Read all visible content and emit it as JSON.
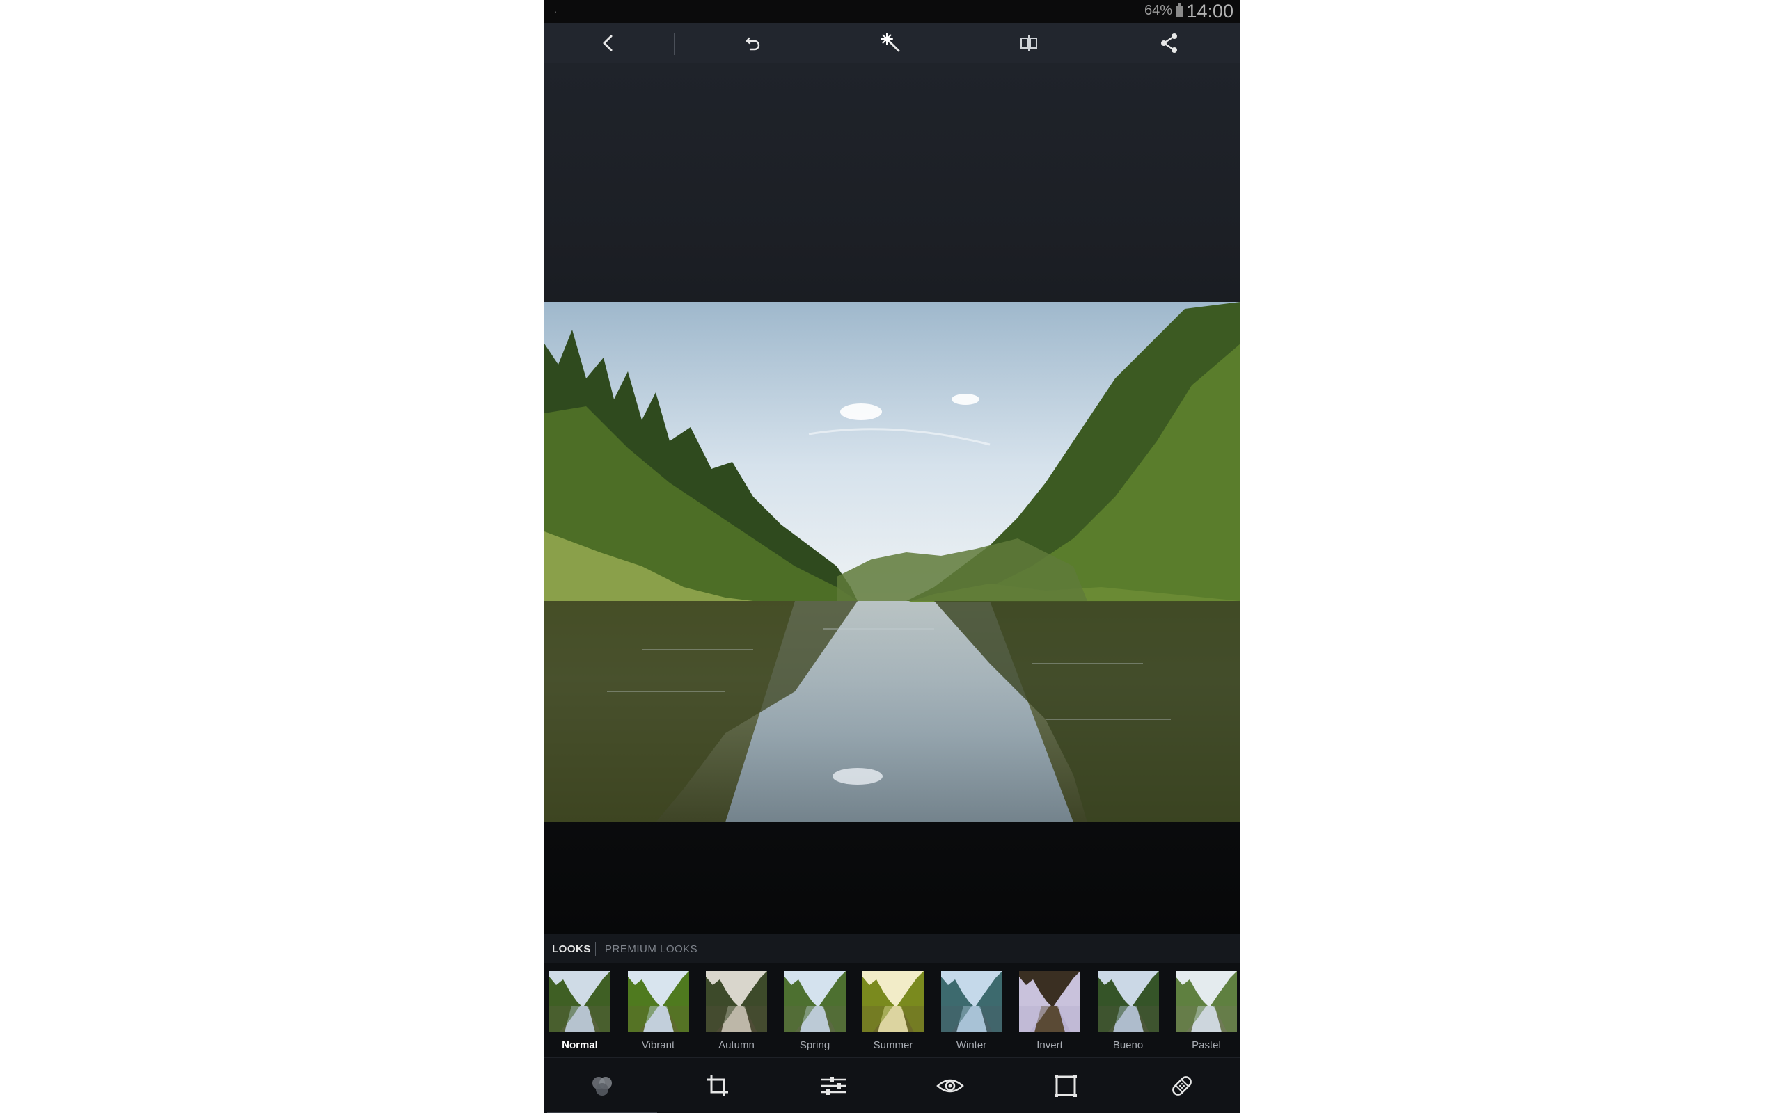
{
  "status_bar": {
    "battery": "64%",
    "time": "14:00"
  },
  "toolbar": {
    "items": [
      "back-icon",
      "undo-icon",
      "auto-enhance-wand-icon",
      "compare-icon",
      "share-icon"
    ]
  },
  "looks": {
    "tabs": [
      {
        "label": "LOOKS",
        "active": true
      },
      {
        "label": "PREMIUM LOOKS",
        "active": false
      }
    ],
    "presets": [
      {
        "label": "Normal",
        "selected": true
      },
      {
        "label": "Vibrant",
        "selected": false
      },
      {
        "label": "Autumn",
        "selected": false
      },
      {
        "label": "Spring",
        "selected": false
      },
      {
        "label": "Summer",
        "selected": false
      },
      {
        "label": "Winter",
        "selected": false
      },
      {
        "label": "Invert",
        "selected": false
      },
      {
        "label": "Bueno",
        "selected": false
      },
      {
        "label": "Pastel",
        "selected": false
      }
    ]
  },
  "bottom_nav": {
    "items": [
      "looks-icon",
      "crop-icon",
      "adjust-sliders-icon",
      "red-eye-icon",
      "borders-icon",
      "spot-heal-bandage-icon"
    ],
    "active_index": 0
  },
  "colors": {
    "toolbar_bg": "#22262e",
    "canvas_bg": "#1c1f25",
    "nav_bg": "#101216",
    "active_text": "#ffffff",
    "inactive_text": "#a8acb3"
  }
}
